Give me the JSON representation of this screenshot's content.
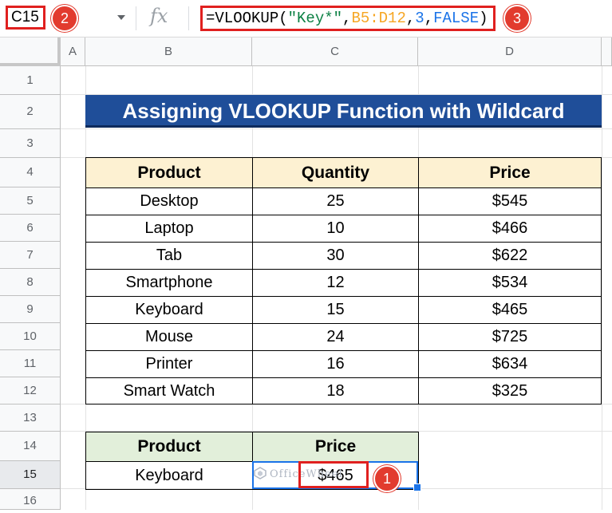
{
  "formula_bar": {
    "name_box": "C15",
    "fx_label": "fx",
    "formula_parts": {
      "p1": "=VLOOKUP(",
      "p2": "\"Key*\"",
      "p3": ",",
      "p4": "B5:D12",
      "p5": ",",
      "p6": "3",
      "p7": ",",
      "p8": "FALSE",
      "p9": ")"
    }
  },
  "badges": {
    "one": "1",
    "two": "2",
    "three": "3"
  },
  "columns": [
    "A",
    "B",
    "C",
    "D"
  ],
  "rows": [
    "1",
    "2",
    "3",
    "4",
    "5",
    "6",
    "7",
    "8",
    "9",
    "10",
    "11",
    "12",
    "13",
    "14",
    "15",
    "16"
  ],
  "title": "Assigning VLOOKUP Function with Wildcard",
  "table": {
    "headers": [
      "Product",
      "Quantity",
      "Price"
    ],
    "rows": [
      [
        "Desktop",
        "25",
        "$545"
      ],
      [
        "Laptop",
        "10",
        "$466"
      ],
      [
        "Tab",
        "30",
        "$622"
      ],
      [
        "Smartphone",
        "12",
        "$534"
      ],
      [
        "Keyboard",
        "15",
        "$465"
      ],
      [
        "Mouse",
        "24",
        "$725"
      ],
      [
        "Printer",
        "16",
        "$634"
      ],
      [
        "Smart Watch",
        "18",
        "$325"
      ]
    ]
  },
  "lookup": {
    "headers": [
      "Product",
      "Price"
    ],
    "product": "Keyboard",
    "price": "$465"
  },
  "watermark": "OfficeWheel",
  "colors": {
    "title_bg": "#1f4e99",
    "header_yellow": "#fdf1d2",
    "header_green": "#e2efda",
    "highlight_red": "#e0201f",
    "selection_blue": "#1a73e8"
  }
}
